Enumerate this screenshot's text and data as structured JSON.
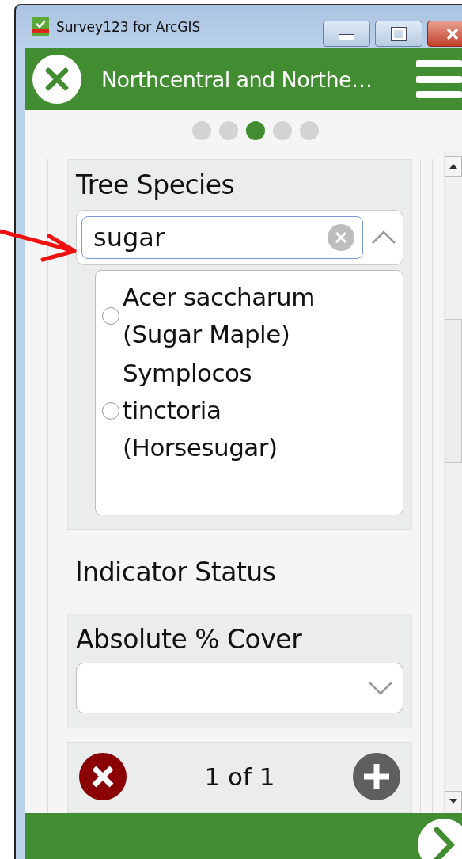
{
  "window": {
    "title": "Survey123 for ArcGIS"
  },
  "header": {
    "title": "Northcentral and Northe…"
  },
  "pages": [
    {
      "selected": false
    },
    {
      "selected": false
    },
    {
      "selected": true
    },
    {
      "selected": false
    },
    {
      "selected": false
    }
  ],
  "tree_species": {
    "label": "Tree Species",
    "search": {
      "value": "sugar"
    },
    "expanded": true,
    "options": [
      {
        "label": "Acer saccharum (Sugar Maple)",
        "selected": false
      },
      {
        "label": "Symplocos tinctoria (Horsesugar)",
        "selected": false
      }
    ]
  },
  "indicator_status": {
    "label": "Indicator Status"
  },
  "absolute_cover": {
    "label": "Absolute % Cover"
  },
  "repeat": {
    "counter": "1 of 1"
  }
}
